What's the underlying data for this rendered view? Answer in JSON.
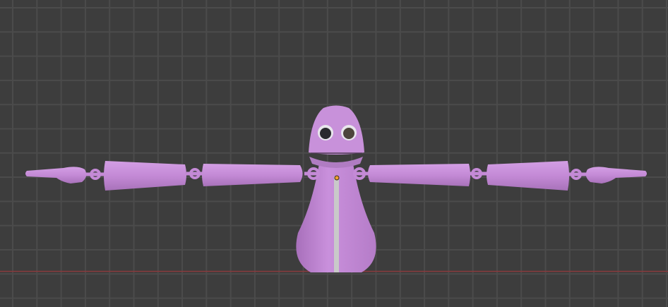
{
  "viewport": {
    "background_color": "#3d3d3d",
    "grid_color": "#4b4b4b",
    "x_axis_color": "#8a3a3d"
  },
  "model": {
    "body_color": "#c48ad6",
    "body_shade_color": "#a872ba",
    "zipper_color": "#c9c9c9",
    "eye_white_color": "#e8e6ec",
    "pupil_color": "#2a2a2e",
    "origin_color": "#f0a030"
  }
}
